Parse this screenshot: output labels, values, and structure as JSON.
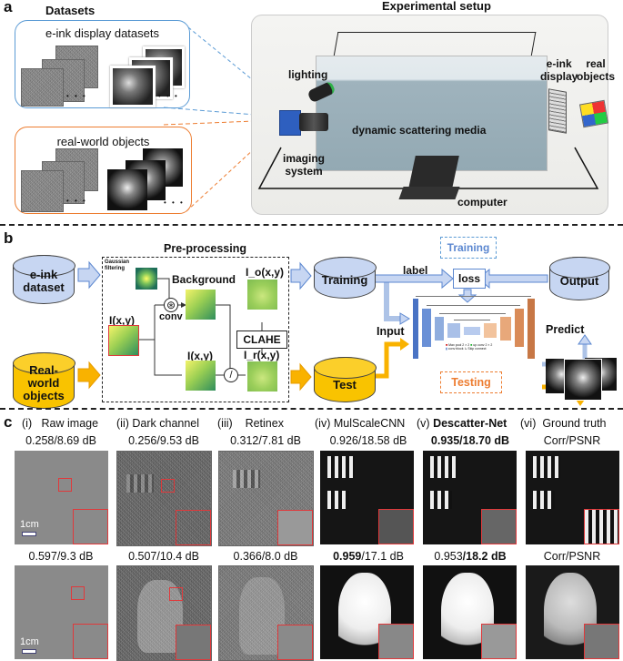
{
  "panel_a": {
    "letter": "a",
    "datasets_title": "Datasets",
    "eink_box_label": "e-ink display datasets",
    "real_box_label": "real-world objects",
    "ellipsis": "• • •",
    "setup_title": "Experimental setup",
    "labels": {
      "lighting": "lighting",
      "imaging_system_1": "imaging",
      "imaging_system_2": "system",
      "scattering_media": "dynamic scattering media",
      "computer": "computer",
      "eink_display_1": "e-ink",
      "eink_display_2": "display",
      "real_objects_1": "real",
      "real_objects_2": "objects"
    },
    "colors": {
      "eink_border": "#5b9bd5",
      "real_border": "#ed7d31"
    }
  },
  "panel_b": {
    "letter": "b",
    "eink_dataset_1": "e-ink",
    "eink_dataset_2": "dataset",
    "real_world_1": "Real-",
    "real_world_2": "world",
    "real_world_3": "objects",
    "preprocessing_title": "Pre-processing",
    "gaussian_1": "Gaussian",
    "gaussian_2": "filtering",
    "background": "Background",
    "conv": "conv",
    "ixy_input": "I(x,y)",
    "ixy_lower": "I(x,y)",
    "io": "I_o(x,y)",
    "ir": "I_r(x,y)",
    "clahe": "CLAHE",
    "conv_symbol": "⊛",
    "divide_symbol": "/",
    "training_db": "Training",
    "test_db": "Test",
    "training_tag": "Training",
    "testing_tag": "Testing",
    "label": "label",
    "loss": "loss",
    "input": "Input",
    "output": "Output",
    "predict": "Predict",
    "unet_legend": {
      "maxpool": "Max pool 2 × 2",
      "upconv": "up conv 2 × 2",
      "convblock": "conv block",
      "skip": "Skip connect"
    },
    "colors": {
      "blue": "#c7d6f2",
      "orange": "#f9c300",
      "training_tag": "#5b9bd5",
      "testing_tag": "#ed7d31"
    }
  },
  "panel_c": {
    "letter": "c",
    "scale_bar": "1cm",
    "columns": [
      {
        "numeral": "(i)",
        "name": "Raw image",
        "bold": false,
        "row1": "0.258/8.69 dB",
        "row2": "0.597/9.3 dB"
      },
      {
        "numeral": "(ii)",
        "name": "Dark channel",
        "bold": false,
        "row1": "0.256/9.53 dB",
        "row2": "0.507/10.4 dB"
      },
      {
        "numeral": "(iii)",
        "name": "Retinex",
        "bold": false,
        "row1": "0.312/7.81 dB",
        "row2": "0.366/8.0 dB"
      },
      {
        "numeral": "(iv)",
        "name": "MulScaleCNN",
        "bold": false,
        "row1": "0.926/18.58 dB",
        "row2_bold": "0.959",
        "row2_rest": "/17.1 dB"
      },
      {
        "numeral": "(v)",
        "name": "Descatter-Net",
        "bold": true,
        "row1": "0.935/18.70 dB",
        "row2_plain": "0.953",
        "row2_bold": "/18.2 dB"
      },
      {
        "numeral": "(vi)",
        "name": "Ground truth",
        "bold": false,
        "row1": "Corr/PSNR",
        "row2": "Corr/PSNR"
      }
    ]
  }
}
